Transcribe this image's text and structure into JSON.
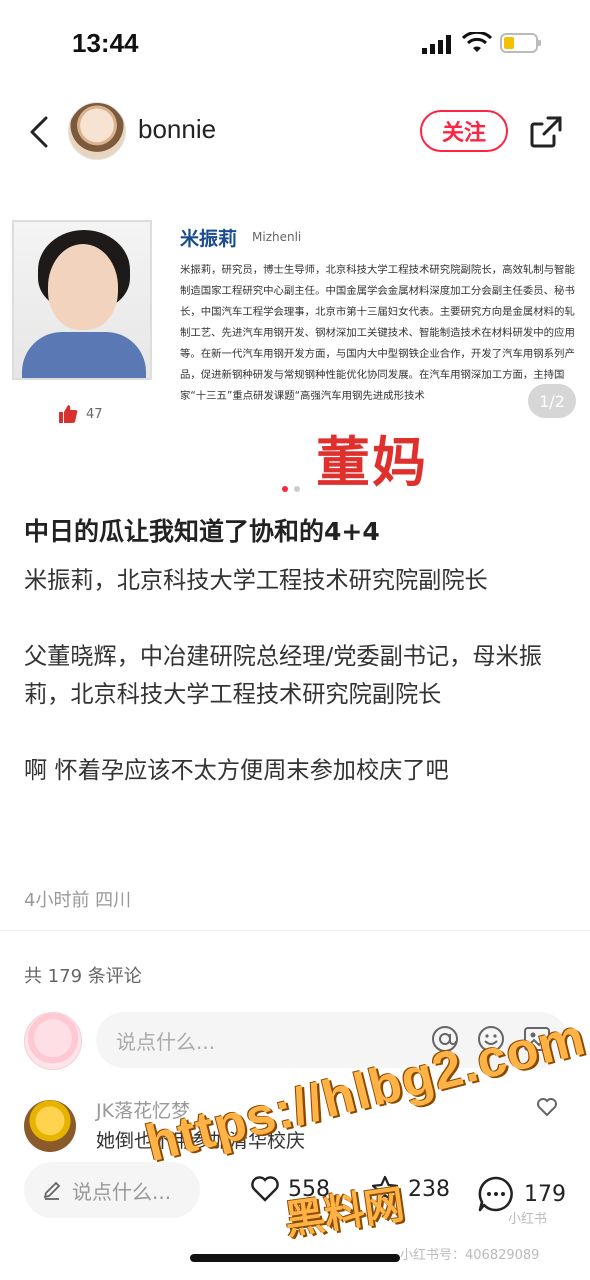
{
  "status_bar": {
    "time": "13:44"
  },
  "header": {
    "username": "bonnie",
    "follow_label": "关注"
  },
  "image_card": {
    "name": "米振莉",
    "pinyin": "Mizhenli",
    "bio": "米振莉，研究员，博士生导师，北京科技大学工程技术研究院副院长，高效轧制与智能制造国家工程研究中心副主任。中国金属学会金属材料深度加工分会副主任委员、秘书长，中国汽车工程学会理事，北京市第十三届妇女代表。主要研究方向是金属材料的轧制工艺、先进汽车用钢开发、钢材深加工关键技术、智能制造技术在材料研发中的应用等。在新一代汽车用钢开发方面，与国内大中型钢铁企业合作，开发了汽车用钢系列产品，促进新钢种研发与常规钢种性能优化协同发展。在汽车用钢深加工方面，主持国家“十三五”重点研发课题“高强汽车用钢先进成形技术",
    "likes": "47",
    "page_indicator": "1/2",
    "overlay_text": "董妈"
  },
  "post": {
    "title": "中日的瓜让我知道了协和的4+4",
    "paragraphs": [
      "米振莉，北京科技大学工程技术研究院副院长",
      "父董晓辉，中冶建研院总经理/党委副书记，母米振莉，北京科技大学工程技术研究院副院长",
      "啊 怀着孕应该不太方便周末参加校庆了吧"
    ],
    "meta": "4小时前 四川"
  },
  "comments": {
    "count_label": "共 179 条评论",
    "input_placeholder": "说点什么...",
    "first": {
      "name": "JK落花忆梦",
      "text": "她倒也不用参加清华校庆"
    }
  },
  "bottom_bar": {
    "say_label": "说点什么...",
    "like_count": "558",
    "collect_count": "238",
    "comment_count": "179"
  },
  "watermarks": {
    "url": "https://hlbg2.com",
    "cn": "黑料网",
    "xhs": "小红书",
    "id": "小红书号：406829089"
  },
  "colors": {
    "accent": "#ff2442",
    "overlay_red": "#e0302e",
    "name_blue": "#1a4b8f",
    "watermark_orange": "#ffb347"
  },
  "icons": {
    "back": "chevron-left-icon",
    "share": "share-icon",
    "signal": "signal-icon",
    "wifi": "wifi-icon",
    "battery": "battery-icon",
    "at": "at-icon",
    "emoji": "emoji-icon",
    "image": "image-icon",
    "like": "heart-icon",
    "collect": "star-icon",
    "comment": "comment-icon",
    "pencil": "pencil-icon"
  }
}
